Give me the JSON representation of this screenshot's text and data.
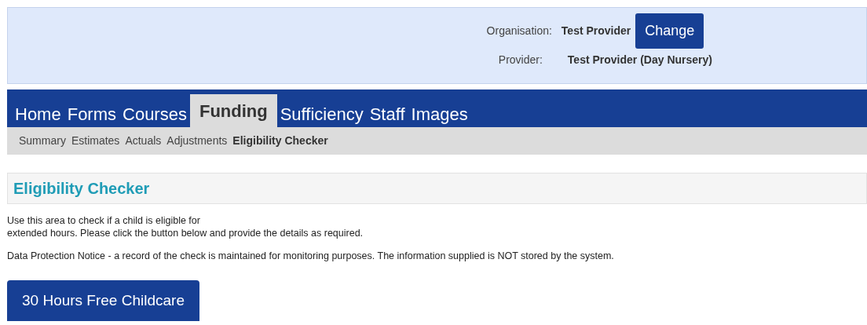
{
  "header": {
    "organisation_label": "Organisation:",
    "organisation_value": "Test Provider",
    "change_button": "Change",
    "provider_label": "Provider:",
    "provider_value": "Test Provider (Day Nursery)"
  },
  "nav": [
    {
      "label": "Home",
      "selected": false
    },
    {
      "label": "Forms",
      "selected": false
    },
    {
      "label": "Courses",
      "selected": false
    },
    {
      "label": "Funding",
      "selected": true
    },
    {
      "label": "Sufficiency",
      "selected": false
    },
    {
      "label": "Staff",
      "selected": false
    },
    {
      "label": "Images",
      "selected": false
    }
  ],
  "subnav": [
    {
      "label": "Summary",
      "selected": false
    },
    {
      "label": "Estimates",
      "selected": false
    },
    {
      "label": "Actuals",
      "selected": false
    },
    {
      "label": "Adjustments",
      "selected": false
    },
    {
      "label": "Eligibility Checker",
      "selected": true
    }
  ],
  "section_title": "Eligibility Checker",
  "intro_lines": [
    "Use this area to check if a child is eligible for",
    "extended hours. Please click the button below and provide the details as required."
  ],
  "notice": "Data Protection Notice - a record of the check is maintained for monitoring purposes. The information supplied is NOT stored by the system.",
  "action_button": "30 Hours Free Childcare"
}
